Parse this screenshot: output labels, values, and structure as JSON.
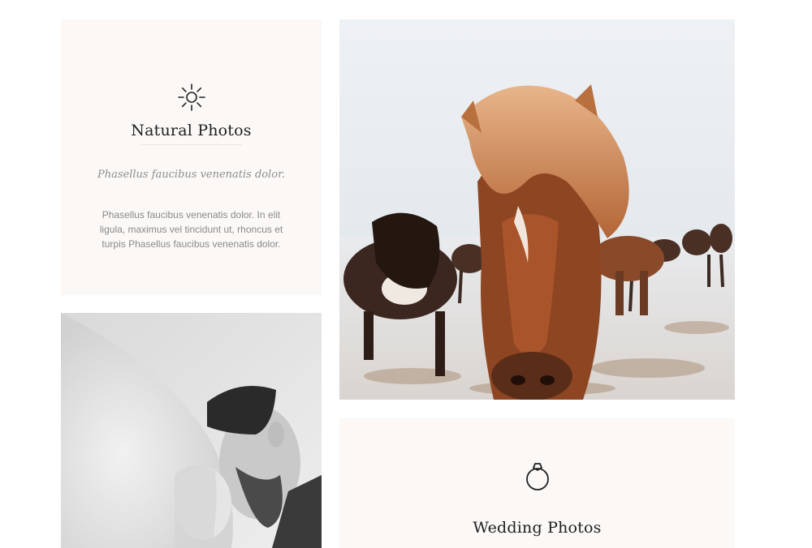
{
  "cards": {
    "natural": {
      "icon": "sun-icon",
      "title": "Natural Photos",
      "subtitle": "Phasellus faucibus venenatis dolor.",
      "body_lines": [
        "Phasellus faucibus venenatis dolor. In elit",
        "ligula, maximus vel tincidunt ut, rhoncus et",
        "turpis Phasellus faucibus venenatis dolor."
      ]
    },
    "wedding": {
      "icon": "ring-icon",
      "title": "Wedding Photos"
    }
  },
  "photos": {
    "horses": {
      "subject": "icelandic-horses-in-snow"
    },
    "wedding": {
      "subject": "wedding-couple-black-and-white"
    }
  },
  "colors": {
    "card_background": "#fbf8f6",
    "title": "#1f1f1f",
    "subtitle": "#8e8e8e",
    "body": "#8a8a8a"
  }
}
